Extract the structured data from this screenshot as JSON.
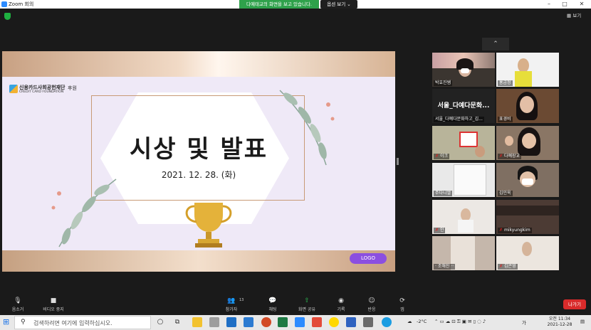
{
  "window": {
    "title": "Zoom 회의"
  },
  "banner": {
    "share_text": "다예태교의 화면을 보고 있습니다.",
    "view_options": "옵션 보기 ⌄"
  },
  "gallery": {
    "label": "보기"
  },
  "slide": {
    "org_name": "신용카드사회공헌재단",
    "org_sub": "CREDIT CARD FOUNDATION",
    "sponsor": "후원",
    "headline": "시상 및 발표",
    "date": "2021. 12. 28. (화)",
    "logo_label": "LOGO"
  },
  "participants": [
    {
      "name": "박효진쌤",
      "muted": false,
      "kind": "video"
    },
    {
      "name": "홍금정",
      "muted": false,
      "kind": "video"
    },
    {
      "name": "서울_다예다문화하고_김...",
      "muted": false,
      "kind": "text",
      "big": "서울_다예다문화..."
    },
    {
      "name": "표경비",
      "muted": false,
      "kind": "video"
    },
    {
      "name": "이크",
      "muted": true,
      "kind": "video"
    },
    {
      "name": "다예장교",
      "muted": true,
      "kind": "video"
    },
    {
      "name": "주다니엘",
      "muted": false,
      "kind": "video"
    },
    {
      "name": "김민욱",
      "muted": false,
      "kind": "video"
    },
    {
      "name": "인",
      "muted": true,
      "kind": "video"
    },
    {
      "name": "mikyungkim",
      "muted": true,
      "kind": "video"
    },
    {
      "name": "· 조해진 ··",
      "muted": false,
      "kind": "video"
    },
    {
      "name": "김은영",
      "muted": true,
      "kind": "video"
    }
  ],
  "toolbar": {
    "mute": "음소거",
    "video": "비디오 중지",
    "participants": "참가자",
    "participants_count": "13",
    "chat": "채팅",
    "share": "화면 공유",
    "record": "기록",
    "reactions": "반응",
    "apps": "앱",
    "leave": "나가기"
  },
  "taskbar": {
    "search_placeholder": "검색하려면 여기에 입력하십시오.",
    "temperature": "-2°C",
    "ime": "가",
    "time": "오전 11:34",
    "date": "2021-12-28"
  },
  "colors": {
    "leave": "#d92b2b",
    "share_banner": "#2fa14b",
    "logo_pill": "#8b4fe0"
  }
}
